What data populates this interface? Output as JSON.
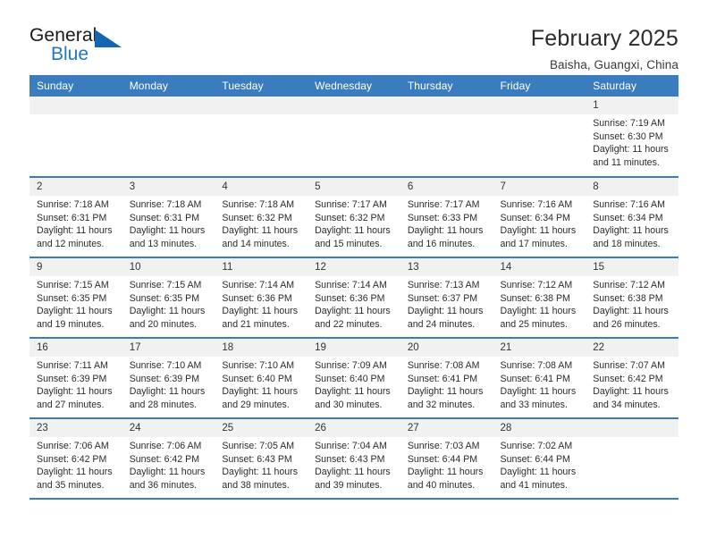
{
  "brand": {
    "name_part1": "General",
    "name_part2": "Blue",
    "accent_color": "#1f77c4",
    "triangle_color": "#1565b0"
  },
  "header": {
    "title": "February 2025",
    "subtitle": "Baisha, Guangxi, China",
    "header_bg": "#3a7cbe",
    "daynum_bg": "#f1f1f1"
  },
  "weekday_headers": [
    "Sunday",
    "Monday",
    "Tuesday",
    "Wednesday",
    "Thursday",
    "Friday",
    "Saturday"
  ],
  "weeks": [
    [
      {
        "day": "",
        "sunrise": "",
        "sunset": "",
        "daylight_line1": "",
        "daylight_line2": "",
        "empty": true
      },
      {
        "day": "",
        "sunrise": "",
        "sunset": "",
        "daylight_line1": "",
        "daylight_line2": "",
        "empty": true
      },
      {
        "day": "",
        "sunrise": "",
        "sunset": "",
        "daylight_line1": "",
        "daylight_line2": "",
        "empty": true
      },
      {
        "day": "",
        "sunrise": "",
        "sunset": "",
        "daylight_line1": "",
        "daylight_line2": "",
        "empty": true
      },
      {
        "day": "",
        "sunrise": "",
        "sunset": "",
        "daylight_line1": "",
        "daylight_line2": "",
        "empty": true
      },
      {
        "day": "",
        "sunrise": "",
        "sunset": "",
        "daylight_line1": "",
        "daylight_line2": "",
        "empty": true
      },
      {
        "day": "1",
        "sunrise": "Sunrise: 7:19 AM",
        "sunset": "Sunset: 6:30 PM",
        "daylight_line1": "Daylight: 11 hours",
        "daylight_line2": "and 11 minutes.",
        "empty": false
      }
    ],
    [
      {
        "day": "2",
        "sunrise": "Sunrise: 7:18 AM",
        "sunset": "Sunset: 6:31 PM",
        "daylight_line1": "Daylight: 11 hours",
        "daylight_line2": "and 12 minutes.",
        "empty": false
      },
      {
        "day": "3",
        "sunrise": "Sunrise: 7:18 AM",
        "sunset": "Sunset: 6:31 PM",
        "daylight_line1": "Daylight: 11 hours",
        "daylight_line2": "and 13 minutes.",
        "empty": false
      },
      {
        "day": "4",
        "sunrise": "Sunrise: 7:18 AM",
        "sunset": "Sunset: 6:32 PM",
        "daylight_line1": "Daylight: 11 hours",
        "daylight_line2": "and 14 minutes.",
        "empty": false
      },
      {
        "day": "5",
        "sunrise": "Sunrise: 7:17 AM",
        "sunset": "Sunset: 6:32 PM",
        "daylight_line1": "Daylight: 11 hours",
        "daylight_line2": "and 15 minutes.",
        "empty": false
      },
      {
        "day": "6",
        "sunrise": "Sunrise: 7:17 AM",
        "sunset": "Sunset: 6:33 PM",
        "daylight_line1": "Daylight: 11 hours",
        "daylight_line2": "and 16 minutes.",
        "empty": false
      },
      {
        "day": "7",
        "sunrise": "Sunrise: 7:16 AM",
        "sunset": "Sunset: 6:34 PM",
        "daylight_line1": "Daylight: 11 hours",
        "daylight_line2": "and 17 minutes.",
        "empty": false
      },
      {
        "day": "8",
        "sunrise": "Sunrise: 7:16 AM",
        "sunset": "Sunset: 6:34 PM",
        "daylight_line1": "Daylight: 11 hours",
        "daylight_line2": "and 18 minutes.",
        "empty": false
      }
    ],
    [
      {
        "day": "9",
        "sunrise": "Sunrise: 7:15 AM",
        "sunset": "Sunset: 6:35 PM",
        "daylight_line1": "Daylight: 11 hours",
        "daylight_line2": "and 19 minutes.",
        "empty": false
      },
      {
        "day": "10",
        "sunrise": "Sunrise: 7:15 AM",
        "sunset": "Sunset: 6:35 PM",
        "daylight_line1": "Daylight: 11 hours",
        "daylight_line2": "and 20 minutes.",
        "empty": false
      },
      {
        "day": "11",
        "sunrise": "Sunrise: 7:14 AM",
        "sunset": "Sunset: 6:36 PM",
        "daylight_line1": "Daylight: 11 hours",
        "daylight_line2": "and 21 minutes.",
        "empty": false
      },
      {
        "day": "12",
        "sunrise": "Sunrise: 7:14 AM",
        "sunset": "Sunset: 6:36 PM",
        "daylight_line1": "Daylight: 11 hours",
        "daylight_line2": "and 22 minutes.",
        "empty": false
      },
      {
        "day": "13",
        "sunrise": "Sunrise: 7:13 AM",
        "sunset": "Sunset: 6:37 PM",
        "daylight_line1": "Daylight: 11 hours",
        "daylight_line2": "and 24 minutes.",
        "empty": false
      },
      {
        "day": "14",
        "sunrise": "Sunrise: 7:12 AM",
        "sunset": "Sunset: 6:38 PM",
        "daylight_line1": "Daylight: 11 hours",
        "daylight_line2": "and 25 minutes.",
        "empty": false
      },
      {
        "day": "15",
        "sunrise": "Sunrise: 7:12 AM",
        "sunset": "Sunset: 6:38 PM",
        "daylight_line1": "Daylight: 11 hours",
        "daylight_line2": "and 26 minutes.",
        "empty": false
      }
    ],
    [
      {
        "day": "16",
        "sunrise": "Sunrise: 7:11 AM",
        "sunset": "Sunset: 6:39 PM",
        "daylight_line1": "Daylight: 11 hours",
        "daylight_line2": "and 27 minutes.",
        "empty": false
      },
      {
        "day": "17",
        "sunrise": "Sunrise: 7:10 AM",
        "sunset": "Sunset: 6:39 PM",
        "daylight_line1": "Daylight: 11 hours",
        "daylight_line2": "and 28 minutes.",
        "empty": false
      },
      {
        "day": "18",
        "sunrise": "Sunrise: 7:10 AM",
        "sunset": "Sunset: 6:40 PM",
        "daylight_line1": "Daylight: 11 hours",
        "daylight_line2": "and 29 minutes.",
        "empty": false
      },
      {
        "day": "19",
        "sunrise": "Sunrise: 7:09 AM",
        "sunset": "Sunset: 6:40 PM",
        "daylight_line1": "Daylight: 11 hours",
        "daylight_line2": "and 30 minutes.",
        "empty": false
      },
      {
        "day": "20",
        "sunrise": "Sunrise: 7:08 AM",
        "sunset": "Sunset: 6:41 PM",
        "daylight_line1": "Daylight: 11 hours",
        "daylight_line2": "and 32 minutes.",
        "empty": false
      },
      {
        "day": "21",
        "sunrise": "Sunrise: 7:08 AM",
        "sunset": "Sunset: 6:41 PM",
        "daylight_line1": "Daylight: 11 hours",
        "daylight_line2": "and 33 minutes.",
        "empty": false
      },
      {
        "day": "22",
        "sunrise": "Sunrise: 7:07 AM",
        "sunset": "Sunset: 6:42 PM",
        "daylight_line1": "Daylight: 11 hours",
        "daylight_line2": "and 34 minutes.",
        "empty": false
      }
    ],
    [
      {
        "day": "23",
        "sunrise": "Sunrise: 7:06 AM",
        "sunset": "Sunset: 6:42 PM",
        "daylight_line1": "Daylight: 11 hours",
        "daylight_line2": "and 35 minutes.",
        "empty": false
      },
      {
        "day": "24",
        "sunrise": "Sunrise: 7:06 AM",
        "sunset": "Sunset: 6:42 PM",
        "daylight_line1": "Daylight: 11 hours",
        "daylight_line2": "and 36 minutes.",
        "empty": false
      },
      {
        "day": "25",
        "sunrise": "Sunrise: 7:05 AM",
        "sunset": "Sunset: 6:43 PM",
        "daylight_line1": "Daylight: 11 hours",
        "daylight_line2": "and 38 minutes.",
        "empty": false
      },
      {
        "day": "26",
        "sunrise": "Sunrise: 7:04 AM",
        "sunset": "Sunset: 6:43 PM",
        "daylight_line1": "Daylight: 11 hours",
        "daylight_line2": "and 39 minutes.",
        "empty": false
      },
      {
        "day": "27",
        "sunrise": "Sunrise: 7:03 AM",
        "sunset": "Sunset: 6:44 PM",
        "daylight_line1": "Daylight: 11 hours",
        "daylight_line2": "and 40 minutes.",
        "empty": false
      },
      {
        "day": "28",
        "sunrise": "Sunrise: 7:02 AM",
        "sunset": "Sunset: 6:44 PM",
        "daylight_line1": "Daylight: 11 hours",
        "daylight_line2": "and 41 minutes.",
        "empty": false
      },
      {
        "day": "",
        "sunrise": "",
        "sunset": "",
        "daylight_line1": "",
        "daylight_line2": "",
        "empty": true
      }
    ]
  ]
}
